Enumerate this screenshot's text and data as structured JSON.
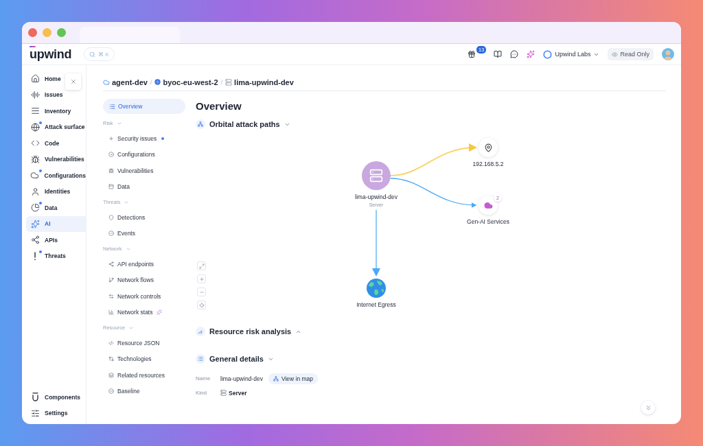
{
  "header": {
    "logo": "upwind",
    "search": {
      "shortcut": "⌘ K"
    },
    "notifications": {
      "count": "13"
    },
    "organization": "Upwind Labs",
    "access": "Read Only"
  },
  "sidebar": {
    "items": [
      {
        "label": "Home",
        "dot": false,
        "selected": false
      },
      {
        "label": "Issues",
        "dot": false,
        "selected": false
      },
      {
        "label": "Inventory",
        "dot": false,
        "selected": false
      },
      {
        "label": "Attack surface",
        "dot": true,
        "selected": false
      },
      {
        "label": "Code",
        "dot": false,
        "selected": false
      },
      {
        "label": "Vulnerabilities",
        "dot": false,
        "selected": false
      },
      {
        "label": "Configurations",
        "dot": true,
        "selected": false
      },
      {
        "label": "Identities",
        "dot": false,
        "selected": false
      },
      {
        "label": "Data",
        "dot": true,
        "selected": false
      },
      {
        "label": "AI",
        "dot": false,
        "selected": true
      },
      {
        "label": "APIs",
        "dot": false,
        "selected": false
      },
      {
        "label": "Threats",
        "dot": true,
        "selected": false
      }
    ],
    "bottom": [
      {
        "label": "Components"
      },
      {
        "label": "Settings"
      }
    ]
  },
  "breadcrumb": {
    "separator": "/",
    "items": [
      "agent-dev",
      "byoc-eu-west-2",
      "lima-upwind-dev"
    ]
  },
  "subnav": {
    "overview": {
      "label": "Overview",
      "selected": true
    },
    "groups": [
      {
        "title": "Risk",
        "expanded": true,
        "items": [
          {
            "label": "Security issues",
            "dot": true,
            "selected": false
          },
          {
            "label": "Configurations",
            "dot": false,
            "selected": false
          },
          {
            "label": "Vulnerabilities",
            "dot": false,
            "selected": false
          },
          {
            "label": "Data",
            "dot": false,
            "selected": false
          }
        ]
      },
      {
        "title": "Threats",
        "expanded": true,
        "items": [
          {
            "label": "Detections",
            "dot": false,
            "selected": false
          },
          {
            "label": "Events",
            "dot": false,
            "selected": false
          }
        ]
      },
      {
        "title": "Network",
        "expanded": true,
        "items": [
          {
            "label": "API endpoints",
            "dot": false,
            "selected": false
          },
          {
            "label": "Network flows",
            "dot": false,
            "selected": false
          },
          {
            "label": "Network controls",
            "dot": false,
            "selected": false
          },
          {
            "label": "Network stats",
            "dot": false,
            "selected": false
          }
        ]
      },
      {
        "title": "Resource",
        "expanded": true,
        "items": [
          {
            "label": "Resource JSON",
            "dot": false,
            "selected": false
          },
          {
            "label": "Technologies",
            "dot": false,
            "selected": false
          },
          {
            "label": "Related resources",
            "dot": false,
            "selected": false
          },
          {
            "label": "Baseline",
            "dot": false,
            "selected": false
          }
        ]
      }
    ]
  },
  "overview": {
    "title": "Overview",
    "sections": [
      {
        "title": "Orbital attack paths",
        "expanded": true
      },
      {
        "title": "Resource risk analysis",
        "expanded": false
      },
      {
        "title": "General details",
        "expanded": true
      }
    ]
  },
  "graph": {
    "nodes": [
      {
        "kind": "ip",
        "label": "192.168.5.2"
      },
      {
        "kind": "server",
        "label": "lima-upwind-dev",
        "sublabel": "Server"
      },
      {
        "kind": "service",
        "label": "Gen-AI Services",
        "badge": "2"
      },
      {
        "kind": "internet",
        "label": "Internet Egress"
      }
    ]
  },
  "details": {
    "rows": [
      {
        "label": "Name",
        "value": "lima-upwind-dev"
      },
      {
        "label": "Kind",
        "value": "Server"
      }
    ],
    "action": "View in map"
  }
}
